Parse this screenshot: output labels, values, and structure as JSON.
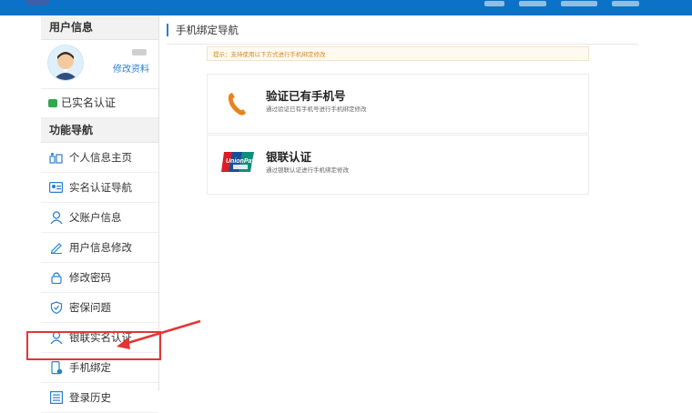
{
  "sidebar": {
    "user_info_title": "用户信息",
    "edit_profile_label": "修改资料",
    "verified_label": "已实名认证",
    "nav_title": "功能导航",
    "items": [
      {
        "label": "个人信息主页",
        "icon": "profile-home-icon"
      },
      {
        "label": "实名认证导航",
        "icon": "id-card-icon"
      },
      {
        "label": "父账户信息",
        "icon": "user-icon"
      },
      {
        "label": "用户信息修改",
        "icon": "pencil-icon"
      },
      {
        "label": "修改密码",
        "icon": "lock-icon"
      },
      {
        "label": "密保问题",
        "icon": "shield-icon"
      },
      {
        "label": "银联实名认证",
        "icon": "user-outline-icon"
      },
      {
        "label": "手机绑定",
        "icon": "phone-bind-icon"
      },
      {
        "label": "登录历史",
        "icon": "history-list-icon"
      }
    ],
    "active_index": 7
  },
  "main": {
    "page_title": "手机绑定导航",
    "tip": "提示：支持使用以下方式进行手机绑定修改",
    "methods": [
      {
        "title": "验证已有手机号",
        "desc": "通过验证已有手机号进行手机绑定修改",
        "icon": "phone-handset-icon"
      },
      {
        "title": "银联认证",
        "desc": "通过银联认证进行手机绑定修改",
        "icon": "unionpay-logo-icon"
      }
    ]
  },
  "colors": {
    "topbar": "#0b72c8",
    "accent": "#2a7fd0",
    "highlight": "#e53535",
    "phone_icon": "#e8841f"
  }
}
